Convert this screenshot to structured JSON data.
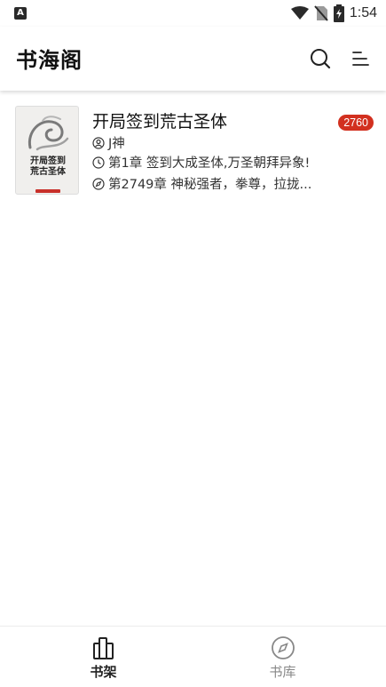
{
  "status_bar": {
    "time": "1:54",
    "notification_icon": "a-icon"
  },
  "app_bar": {
    "title": "书海阁",
    "search_icon": "search-icon",
    "menu_icon": "sort-menu-icon"
  },
  "books": [
    {
      "title": "开局签到荒古圣体",
      "cover_title": "开局签到荒古圣体",
      "author": "J神",
      "last_read": "第1章 签到大成圣体,万圣朝拜异象!",
      "latest_chapter": "第2749章 神秘强者，拳尊，拉拢...",
      "unread_count": "2760"
    }
  ],
  "bottom_nav": {
    "items": [
      {
        "label": "书架",
        "icon": "bookshelf-icon",
        "active": true
      },
      {
        "label": "书库",
        "icon": "compass-icon",
        "active": false
      }
    ]
  },
  "colors": {
    "badge": "#d2301f",
    "active_nav": "#222222",
    "inactive_nav": "#888888"
  }
}
